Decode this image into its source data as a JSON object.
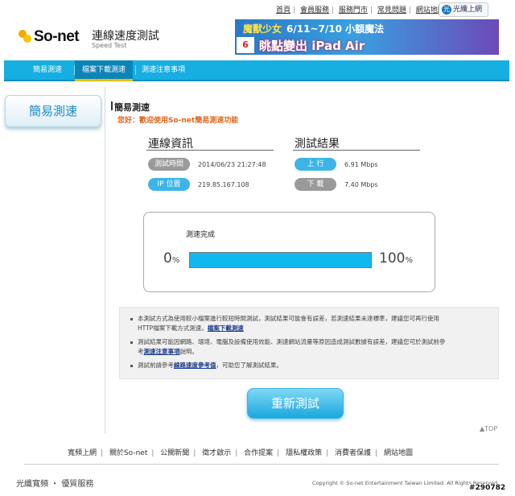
{
  "top_links": [
    "首頁",
    "會員服務",
    "服務門市",
    "常見問題",
    "網站地圖"
  ],
  "fiber_button": {
    "badge": "光",
    "label": "光纖上網"
  },
  "logo": {
    "text": "So-net"
  },
  "header": {
    "title": "連線速度測試",
    "subtitle": "Speed Test"
  },
  "banner": {
    "line1": "魔獸少女",
    "dates": "6/11~7/10 小額魔法",
    "line2": "眺點變出 iPad Air",
    "badge": "6"
  },
  "nav": {
    "items": [
      "簡易測速",
      "檔案下載測速",
      "測速注意事項"
    ],
    "active_index": 1
  },
  "sidebar": {
    "label": "簡易測速"
  },
  "section": {
    "title": "簡易測速",
    "welcome": "您好：歡迎使用So-net簡易測速功能"
  },
  "connection": {
    "heading": "連線資訊",
    "time_label": "測試時間",
    "time_value": "2014/06/23 21:27:48",
    "ip_label": "IP 位置",
    "ip_value": "219.85.167.108"
  },
  "result": {
    "heading": "測試結果",
    "up_label": "上 行",
    "up_value": "6.91 Mbps",
    "down_label": "下 載",
    "down_value": "7.40 Mbps"
  },
  "progress": {
    "status": "測速完成",
    "start": "0",
    "end": "100",
    "unit": "%",
    "percent": 100
  },
  "notes": {
    "n1a": "本測試方式為使用較小檔案進行較短時間測試，測試結果可能會有誤差，若測速結果未達標準，建議您可再行使用",
    "n1b": "HTTP檔案下載方式測速。",
    "n1link": "檔案下載測速",
    "n2a": "測試結果可能因網路、環境、電腦及設備使用效能、測速網站流量等原因造成測試數據有誤差，建議您可於測試前參",
    "n2b": "考",
    "n2link": "測速注意事項",
    "n2c": "說明。",
    "n3a": "測試前請參考",
    "n3link": "線路速度參考值",
    "n3b": "，可助您了解測試結果。"
  },
  "retest_button": "重新測試",
  "top_link": "▲TOP",
  "footer_links": [
    "寬頻上網",
    "關於So-net",
    "公關新聞",
    "徵才啟示",
    "合作提案",
    "隱私權政策",
    "消費者保護",
    "網站地圖"
  ],
  "slogan": "光纖寬頻 ・ 優質服務",
  "copyright": "Copyright © So-net Entertainment Taiwan Limited. All Rights Reserved.",
  "stamp": "#290782",
  "colors": {
    "nav": "#17aee2",
    "accent_orange": "#e5651b",
    "progress": "#11b8f0"
  }
}
